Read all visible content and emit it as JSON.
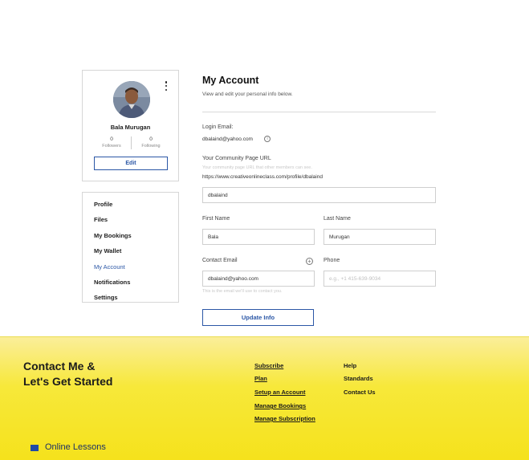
{
  "profile": {
    "name": "Bala Murugan",
    "followers_count": "0",
    "followers_label": "Followers",
    "following_count": "0",
    "following_label": "Following",
    "edit_label": "Edit"
  },
  "menu": {
    "items": [
      {
        "label": "Profile"
      },
      {
        "label": "Files"
      },
      {
        "label": "My Bookings"
      },
      {
        "label": "My Wallet"
      },
      {
        "label": "My Account"
      },
      {
        "label": "Notifications"
      },
      {
        "label": "Settings"
      }
    ],
    "active": "My Account"
  },
  "account": {
    "title": "My Account",
    "subtitle": "View and edit your personal info below.",
    "login_email_label": "Login Email:",
    "login_email": "dbalaind@yahoo.com",
    "community_label": "Your Community Page URL",
    "community_hint": "Your community page URL that other members can see.",
    "community_url": "https://www.creativeonlineclass.com/profile/dbalaind",
    "slug_value": "dbalaind",
    "first_name_label": "First Name",
    "first_name_value": "Bala",
    "last_name_label": "Last Name",
    "last_name_value": "Murugan",
    "contact_email_label": "Contact Email",
    "contact_email_value": "dbalaind@yahoo.com",
    "contact_email_hint": "This is the email we'll use to contact you.",
    "phone_label": "Phone",
    "phone_placeholder": "e.g., +1 415-639-9034",
    "update_label": "Update Info"
  },
  "footer": {
    "heading_line1": "Contact Me &",
    "heading_line2": "Let's Get Started",
    "col1": [
      "Subscribe",
      "Plan",
      "Setup an Account",
      "Manage Bookings",
      "Manage Subscription"
    ],
    "col2": [
      "Help",
      "Standards",
      "Contact Us"
    ],
    "brand": "Online Lessons"
  },
  "colors": {
    "accent": "#2b57a6",
    "footer_bg": "#f5e21c",
    "brand": "#1f4aa6"
  }
}
